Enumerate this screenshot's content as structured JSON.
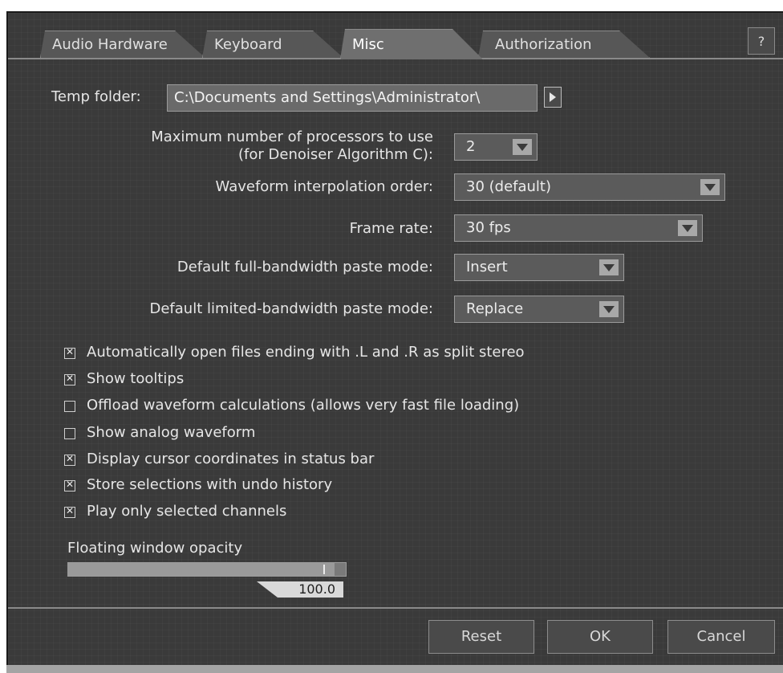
{
  "tabs": [
    {
      "label": "Audio Hardware",
      "active": false
    },
    {
      "label": "Keyboard",
      "active": false
    },
    {
      "label": "Misc",
      "active": true
    },
    {
      "label": "Authorization",
      "active": false
    }
  ],
  "help_label": "?",
  "temp_folder": {
    "label": "Temp folder:",
    "value": "C:\\Documents and Settings\\Administrator\\"
  },
  "processors": {
    "label_line1": "Maximum number of processors to use",
    "label_line2": "(for Denoiser Algorithm C):",
    "value": "2"
  },
  "waveform_interp": {
    "label": "Waveform interpolation order:",
    "value": "30 (default)"
  },
  "frame_rate": {
    "label": "Frame rate:",
    "value": "30 fps"
  },
  "full_paste": {
    "label": "Default full-bandwidth paste mode:",
    "value": "Insert"
  },
  "limited_paste": {
    "label": "Default limited-bandwidth paste mode:",
    "value": "Replace"
  },
  "checkboxes": [
    {
      "label": "Automatically open files ending with .L and .R as split stereo",
      "checked": true
    },
    {
      "label": "Show tooltips",
      "checked": true
    },
    {
      "label": "Offload waveform calculations (allows very fast file loading)",
      "checked": false
    },
    {
      "label": "Show analog waveform",
      "checked": false
    },
    {
      "label": "Display cursor coordinates in status bar",
      "checked": true
    },
    {
      "label": "Store selections with undo history",
      "checked": true
    },
    {
      "label": "Play only selected channels",
      "checked": true
    }
  ],
  "opacity": {
    "label": "Floating window opacity",
    "value": "100.0",
    "fraction": 1.0
  },
  "buttons": {
    "reset": "Reset",
    "ok": "OK",
    "cancel": "Cancel"
  }
}
